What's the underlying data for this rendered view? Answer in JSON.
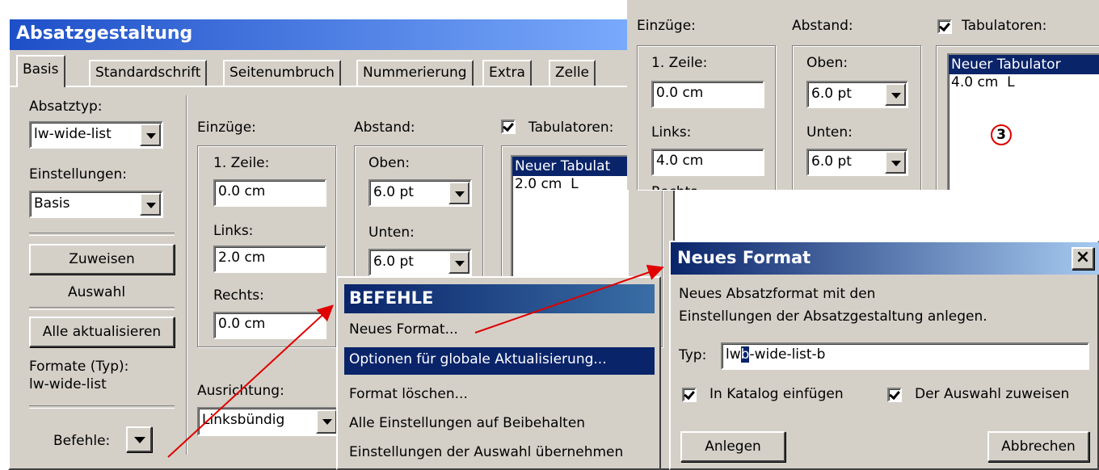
{
  "main": {
    "title": "Absatzgestaltung",
    "tabs": [
      "Basis",
      "Standardschrift",
      "Seitenumbruch",
      "Nummerierung",
      "Extra",
      "Zelle"
    ],
    "absatztyp_label": "Absatztyp:",
    "absatztyp_value": "lw-wide-list",
    "einstellungen_label": "Einstellungen:",
    "einstellungen_value": "Basis",
    "zuweisen_label": "Zuweisen",
    "auswahl_label": "Auswahl",
    "alle_aktualisieren_label": "Alle aktualisieren",
    "formate_label": "Formate (Typ):",
    "formate_value": "lw-wide-list",
    "befehle_label": "Befehle:",
    "einzuege_label": "Einzüge:",
    "zeile1_label": "1. Zeile:",
    "zeile1_value": "0.0 cm",
    "links_label": "Links:",
    "links_value": "2.0 cm",
    "rechts_label": "Rechts:",
    "rechts_value": "0.0 cm",
    "abstand_label": "Abstand:",
    "oben_label": "Oben:",
    "oben_value": "6.0 pt",
    "unten_label": "Unten:",
    "unten_value": "6.0 pt",
    "tabulatoren_label": "Tabulatoren:",
    "tab_items": [
      "Neuer Tabulat",
      "2.0 cm  L"
    ],
    "ausrichtung_label": "Ausrichtung:",
    "ausrichtung_value": "Linksbündig"
  },
  "zoom": {
    "einzuege_label": "Einzüge:",
    "zeile1_label": "1. Zeile:",
    "zeile1_value": "0.0 cm",
    "links_label": "Links:",
    "links_value": "4.0 cm",
    "rechts_partial": "Rechts",
    "abstand_label": "Abstand:",
    "oben_label": "Oben:",
    "oben_value": "6.0 pt",
    "unten_label": "Unten:",
    "unten_value": "6.0 pt",
    "tabulatoren_label": "Tabulatoren:",
    "tab_items": [
      "Neuer Tabulator",
      "4.0 cm  L"
    ],
    "callout": "3"
  },
  "menu": {
    "title": "BEFEHLE",
    "items": [
      "Neues Format...",
      "Optionen für globale Aktualisierung...",
      "Format löschen...",
      "Alle Einstellungen auf Beibehalten",
      "Einstellungen der Auswahl übernehmen"
    ]
  },
  "dialog": {
    "title": "Neues Format",
    "close": "×",
    "desc_line1": "Neues Absatzformat mit den",
    "desc_line2": "Einstellungen der Absatzgestaltung anlegen.",
    "typ_label": "Typ:",
    "typ_value_a": "lw",
    "typ_value_sel": "b",
    "typ_value_b": "-wide-list-b",
    "katalog_label": "In Katalog einfügen",
    "zuweisen_label": "Der Auswahl zuweisen",
    "anlegen_label": "Anlegen",
    "abbrechen_label": "Abbrechen"
  },
  "colors": {
    "title_start": "#1e4fc8",
    "title_end": "#7fb0ff",
    "selection": "#0a246a",
    "arrow": "#e00000",
    "dialog_title": "#0a246a"
  }
}
